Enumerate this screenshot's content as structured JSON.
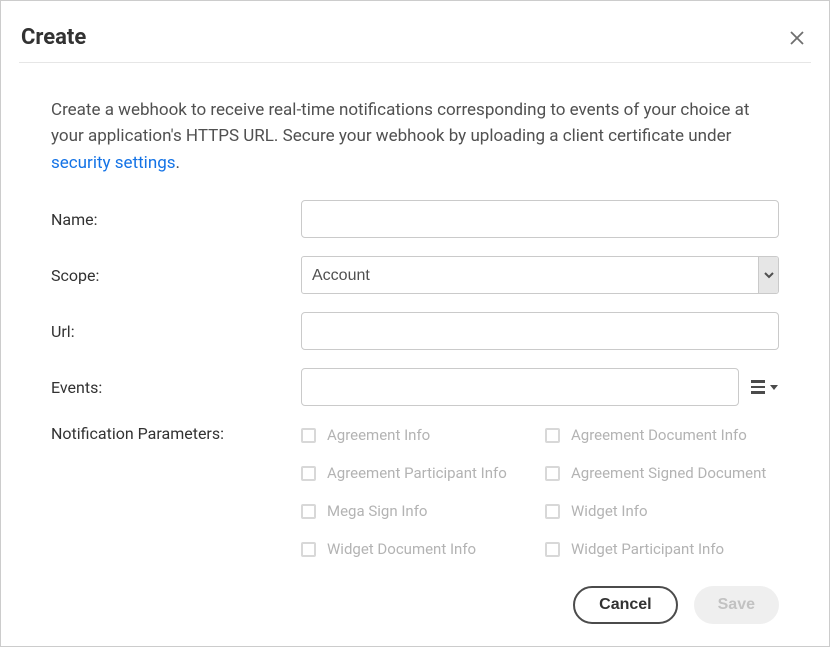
{
  "header": {
    "title": "Create"
  },
  "description": {
    "text_before_link": "Create a webhook to receive real-time notifications corresponding to events of your choice at your application's HTTPS URL. Secure your webhook by uploading a client certificate under ",
    "link_text": "security settings",
    "text_after_link": "."
  },
  "form": {
    "name": {
      "label": "Name:",
      "value": ""
    },
    "scope": {
      "label": "Scope:",
      "selected": "Account"
    },
    "url": {
      "label": "Url:",
      "value": ""
    },
    "events": {
      "label": "Events:",
      "value": ""
    },
    "notification_params": {
      "label": "Notification Parameters:",
      "items": [
        "Agreement Info",
        "Agreement Document Info",
        "Agreement Participant Info",
        "Agreement Signed Document",
        "Mega Sign Info",
        "Widget Info",
        "Widget Document Info",
        "Widget Participant Info"
      ]
    }
  },
  "buttons": {
    "cancel": "Cancel",
    "save": "Save"
  }
}
